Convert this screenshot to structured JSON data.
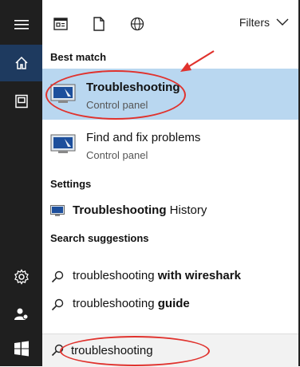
{
  "sidebar": {
    "items": [
      {
        "name": "hamburger-menu-icon"
      },
      {
        "name": "home-icon"
      },
      {
        "name": "documents-icon"
      },
      {
        "name": "settings-gear-icon"
      },
      {
        "name": "user-account-icon"
      },
      {
        "name": "windows-start-icon"
      }
    ]
  },
  "toolbar": {
    "filters_label": "Filters"
  },
  "best_match": {
    "header": "Best match",
    "title": "Troubleshooting",
    "subtitle": "Control panel"
  },
  "result2": {
    "title": "Find and fix problems",
    "subtitle": "Control panel"
  },
  "settings": {
    "header": "Settings",
    "item_bold": "Troubleshooting",
    "item_rest": " History"
  },
  "suggestions": {
    "header": "Search suggestions",
    "items": [
      {
        "prefix": "troubleshooting ",
        "bold": "with wireshark"
      },
      {
        "prefix": "troubleshooting ",
        "bold": "guide"
      }
    ]
  },
  "search": {
    "value": "troubleshooting"
  },
  "colors": {
    "highlight": "#b9d7f0",
    "rail": "#1f1f1f",
    "rail_active": "#1e3a5f",
    "annotation": "#e0322d"
  }
}
